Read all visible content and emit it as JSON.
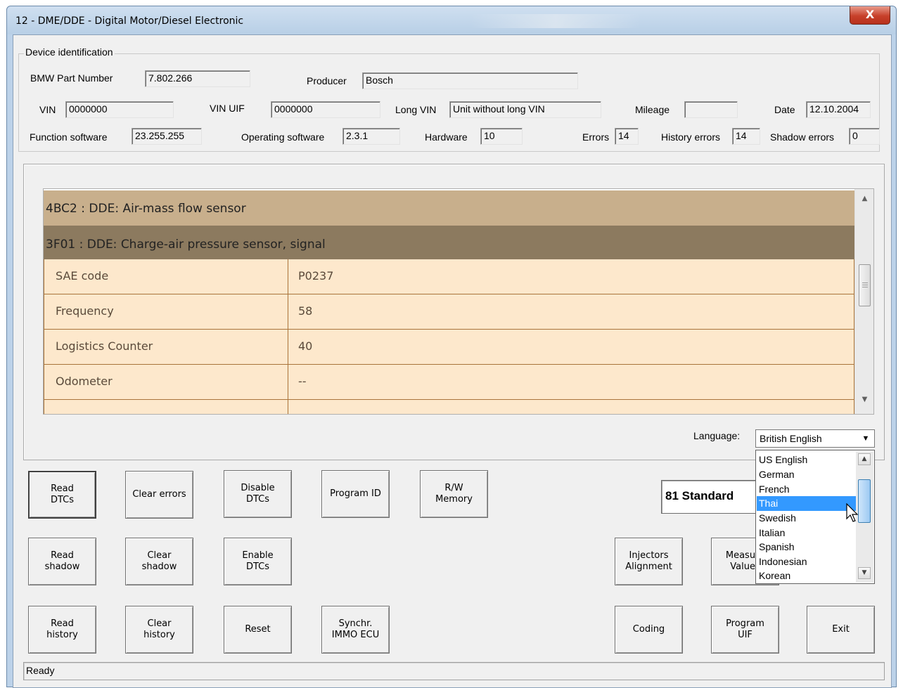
{
  "window": {
    "title": "12 - DME/DDE - Digital Motor/Diesel Electronic",
    "close_glyph": "X"
  },
  "device_identification": {
    "group_title": "Device identification",
    "bmw_part_number": {
      "label": "BMW Part Number",
      "value": "7.802.266"
    },
    "producer": {
      "label": "Producer",
      "value": "Bosch"
    },
    "vin": {
      "label": "VIN",
      "value": "0000000"
    },
    "vin_uif": {
      "label": "VIN UIF",
      "value": "0000000"
    },
    "long_vin": {
      "label": "Long VIN",
      "value": "Unit without long VIN"
    },
    "mileage": {
      "label": "Mileage",
      "value": ""
    },
    "date": {
      "label": "Date",
      "value": "12.10.2004"
    },
    "function_software": {
      "label": "Function software",
      "value": "23.255.255"
    },
    "operating_software": {
      "label": "Operating software",
      "value": "2.3.1"
    },
    "hardware": {
      "label": "Hardware",
      "value": "10"
    },
    "errors": {
      "label": "Errors",
      "value": "14"
    },
    "history_errors": {
      "label": "History errors",
      "value": "14"
    },
    "shadow_errors": {
      "label": "Shadow errors",
      "value": "0"
    }
  },
  "error_list": {
    "headers": [
      "4BC2 : DDE: Air-mass flow sensor",
      "3F01 : DDE: Charge-air pressure sensor, signal"
    ],
    "details": [
      {
        "name": "SAE code",
        "value": "P0237"
      },
      {
        "name": "Frequency",
        "value": "58"
      },
      {
        "name": "Logistics Counter",
        "value": "40"
      },
      {
        "name": "Odometer",
        "value": "--"
      },
      {
        "name": "",
        "value": ""
      }
    ]
  },
  "language": {
    "label": "Language:",
    "selected": "British English",
    "options": [
      "US English",
      "German",
      "French",
      "Thai",
      "Swedish",
      "Italian",
      "Spanish",
      "Indonesian",
      "Korean"
    ],
    "highlighted": "Thai"
  },
  "display": {
    "text": "81 Standard"
  },
  "buttons": {
    "read_dtcs": "Read\nDTCs",
    "clear_errors": "Clear errors",
    "disable_dtcs": "Disable\nDTCs",
    "program_id": "Program ID",
    "rw_memory": "R/W\nMemory",
    "read_shadow": "Read\nshadow",
    "clear_shadow": "Clear\nshadow",
    "enable_dtcs": "Enable\nDTCs",
    "injectors_alignment": "Injectors\nAlignment",
    "measure_values": "Measure\nValues",
    "read_history": "Read\nhistory",
    "clear_history": "Clear\nhistory",
    "reset": "Reset",
    "synchr_immo": "Synchr.\nIMMO ECU",
    "coding": "Coding",
    "program_uif": "Program\nUIF",
    "exit": "Exit"
  },
  "statusbar": {
    "text": "Ready"
  }
}
